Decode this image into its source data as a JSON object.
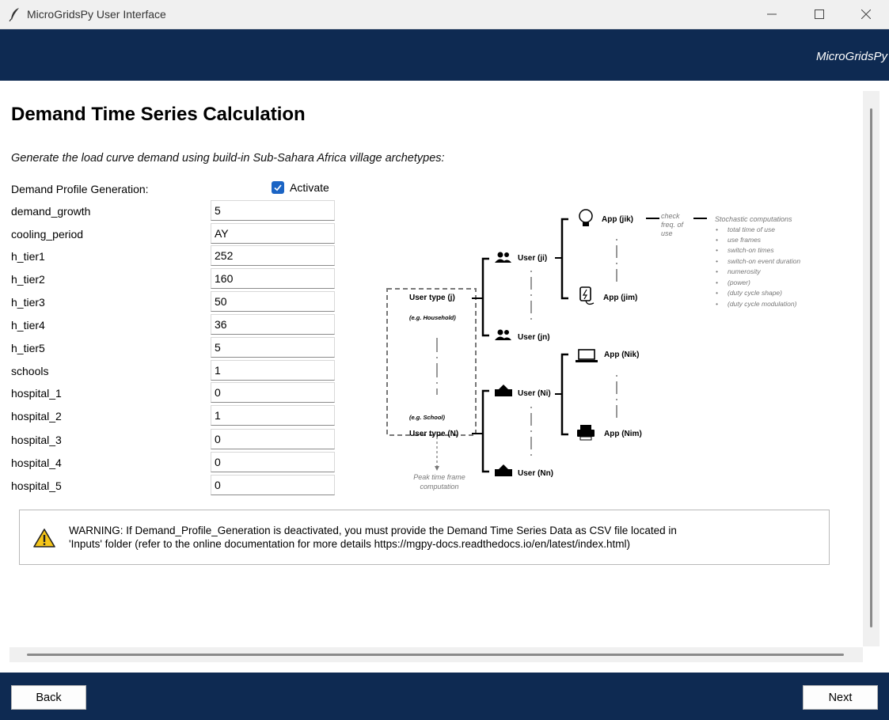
{
  "window": {
    "title": "MicroGridsPy User Interface",
    "icons": [
      "feather-icon",
      "minimize-icon",
      "maximize-icon",
      "close-icon"
    ]
  },
  "header": {
    "brand": "MicroGridsPy"
  },
  "main": {
    "title": "Demand Time Series Calculation",
    "subtitle": "Generate the load curve demand using build-in Sub-Sahara Africa village archetypes:",
    "profile_label": "Demand Profile Generation:",
    "activate_label": "Activate",
    "activate_checked": true,
    "accent_color": "#1b64c4",
    "fields": [
      {
        "label": "demand_growth",
        "value": "5"
      },
      {
        "label": "cooling_period",
        "value": "AY"
      },
      {
        "label": "h_tier1",
        "value": "252"
      },
      {
        "label": "h_tier2",
        "value": "160"
      },
      {
        "label": "h_tier3",
        "value": "50"
      },
      {
        "label": "h_tier4",
        "value": "36"
      },
      {
        "label": "h_tier5",
        "value": "5"
      },
      {
        "label": "schools",
        "value": "1"
      },
      {
        "label": "hospital_1",
        "value": "0"
      },
      {
        "label": "hospital_2",
        "value": "1"
      },
      {
        "label": "hospital_3",
        "value": "0"
      },
      {
        "label": "hospital_4",
        "value": "0"
      },
      {
        "label": "hospital_5",
        "value": "0"
      }
    ]
  },
  "diagram": {
    "user_type_j": "User type (j)",
    "eg_household": "(e.g. Household)",
    "eg_school": "(e.g. School)",
    "user_type_n": "User type (N)",
    "peak": "Peak time frame computation",
    "user_ji": "User (ji)",
    "user_jn": "User (jn)",
    "user_ni": "User (Ni)",
    "user_nn": "User (Nn)",
    "app_jik": "App (jik)",
    "app_jim": "App (jim)",
    "app_nik": "App (Nik)",
    "app_nim": "App (Nim)",
    "check_freq": "check freq. of use",
    "stoch_title": "Stochastic computations",
    "stoch_items": [
      "total time of use",
      "use frames",
      "switch-on times",
      "switch-on event duration",
      "numerosity",
      "(power)",
      "(duty cycle shape)",
      "(duty cycle modulation)"
    ]
  },
  "warning": {
    "line1": "WARNING: If Demand_Profile_Generation is deactivated, you must provide the Demand Time Series Data as CSV file located in",
    "line2": "'Inputs' folder (refer to the online documentation for more details https://mgpy-docs.readthedocs.io/en/latest/index.html)"
  },
  "footer": {
    "back": "Back",
    "next": "Next"
  },
  "colors": {
    "navy": "#0e2a52",
    "warning_yellow": "#f5c518"
  }
}
